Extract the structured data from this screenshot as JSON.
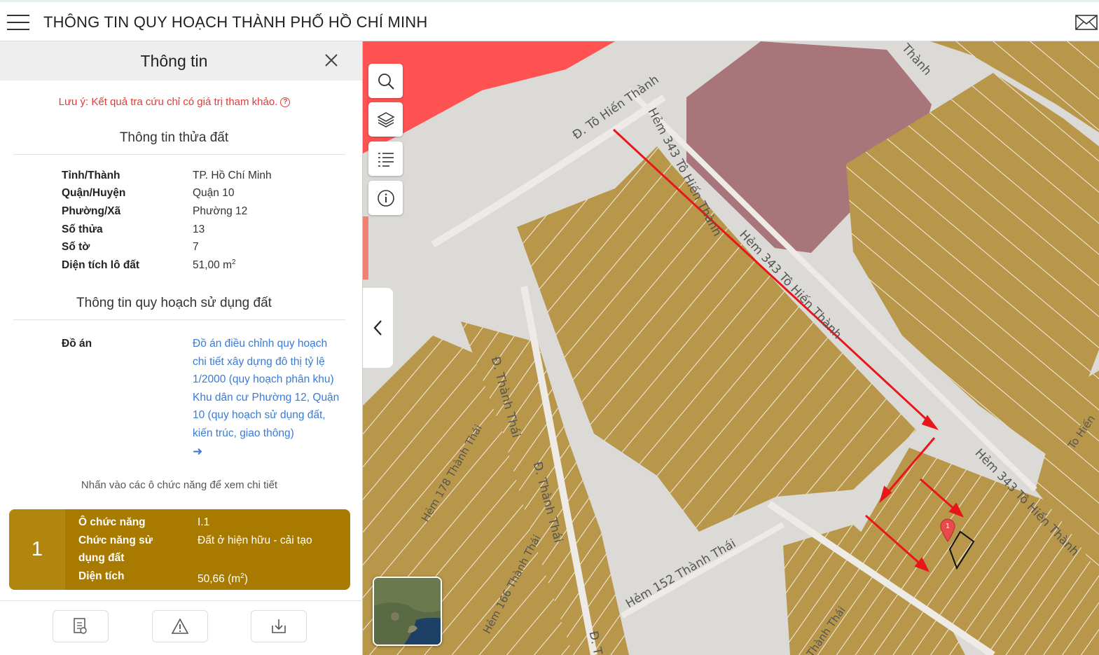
{
  "header": {
    "title": "THÔNG TIN QUY HOẠCH THÀNH PHỐ HỒ CHÍ MINH"
  },
  "panel": {
    "title": "Thông tin",
    "note": "Lưu ý: Kết quả tra cứu chỉ có giá trị tham khảo.",
    "parcel_section_title": "Thông tin thửa đất",
    "parcel_info": [
      {
        "label": "Tỉnh/Thành",
        "value": "TP. Hồ Chí Minh"
      },
      {
        "label": "Quận/Huyện",
        "value": "Quận 10"
      },
      {
        "label": "Phường/Xã",
        "value": "Phường 12"
      },
      {
        "label": "Số thửa",
        "value": "13"
      },
      {
        "label": "Số tờ",
        "value": "7"
      },
      {
        "label": "Diện tích lô đất",
        "value": "51,00 m",
        "unit_sup": "2"
      }
    ],
    "planning_section_title": "Thông tin quy hoạch sử dụng đất",
    "do_an_label": "Đồ án",
    "do_an_link": "Đồ án điều chỉnh quy hoạch chi tiết xây dựng đô thị tỷ lệ 1/2000 (quy hoạch phân khu) Khu dân cư Phường 12, Quận 10 (quy hoạch sử dụng đất, kiến trúc, giao thông)",
    "hint": "Nhấn vào các ô chức năng để xem chi tiết",
    "zone_card": {
      "number": "1",
      "color": "#a87a00",
      "rows": [
        {
          "label": "Ô chức năng",
          "value": "I.1"
        },
        {
          "label": "Chức năng sử dụng đất",
          "value": "Đất ở hiện hữu - cải tạo"
        },
        {
          "label": "Diện tích",
          "value": "50,66 (m",
          "unit_sup": "2",
          "suffix": ")"
        }
      ]
    }
  },
  "map": {
    "streets": {
      "to_hien_thanh": "Đ. Tô Hiến Thành",
      "hem_343_a": "Hẻm 343 Tô Hiến Thành",
      "hem_343_b": "Hẻm 343 Tô Hiến Thành",
      "hem_343_c": "Hẻm 343 Tô Hiến Thành",
      "thanh_thai_a": "Đ. Thành Thái",
      "thanh_thai_b": "Đ. Thành Thái",
      "hem_152": "Hẻm 152 Thành Thái",
      "hem_178": "Hẻm 178 Thành Thái",
      "hem_166": "Hẻm 166 Thành Thái",
      "thanh_thai_frag": "Thành Thái",
      "to_hien_frag": "To Hiến",
      "thanh_frag": "Thành",
      "d_frag": "Đ. T"
    },
    "marker_label": "1",
    "colors": {
      "residential": "#b8974a",
      "road": "#dcdad6",
      "commercial": "#ff5252",
      "public": "#a8767a",
      "arrow": "#e8161b"
    }
  }
}
